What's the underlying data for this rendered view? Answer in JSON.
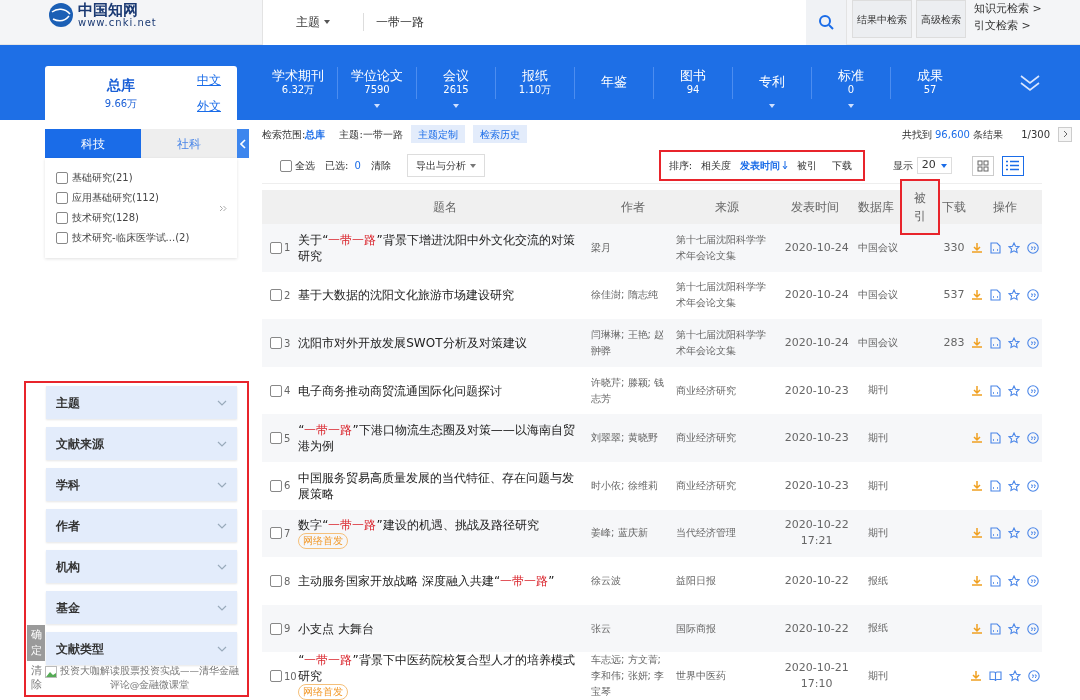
{
  "header": {
    "logo_text": "中国知网",
    "logo_url": "www.cnki.net",
    "search_field": "主题",
    "search_value": "一带一路",
    "buttons": [
      "结果中检索",
      "高级检索"
    ],
    "links": [
      "知识元检索 >",
      "引文检索 >"
    ]
  },
  "library": {
    "title": "总库",
    "count": "9.66万",
    "langs": [
      "中文",
      "外文"
    ]
  },
  "nav": [
    {
      "label": "学术期刊",
      "count": "6.32万",
      "caret": false
    },
    {
      "label": "学位论文",
      "count": "7590",
      "caret": true
    },
    {
      "label": "会议",
      "count": "2615",
      "caret": true
    },
    {
      "label": "报纸",
      "count": "1.10万",
      "caret": false
    },
    {
      "label": "年鉴",
      "caret": false
    },
    {
      "label": "图书",
      "count": "94",
      "caret": false
    },
    {
      "label": "专利",
      "caret": true
    },
    {
      "label": "标准",
      "count": "0",
      "caret": true
    },
    {
      "label": "成果",
      "count": "57",
      "caret": false
    }
  ],
  "subject_tabs": [
    {
      "label": "科技",
      "selected": true
    },
    {
      "label": "社科",
      "selected": false
    }
  ],
  "subject_items": [
    {
      "label": "基础研究(21)",
      "checked": false
    },
    {
      "label": "应用基础研究(112)",
      "checked": false
    },
    {
      "label": "技术研究(128)",
      "checked": false
    },
    {
      "label": "技术研究-临床医学试...(2)",
      "checked": false
    }
  ],
  "filters": {
    "highlighted": true,
    "groups": [
      {
        "label": "主题",
        "expanded": false
      },
      {
        "label": "文献来源",
        "expanded": false
      },
      {
        "label": "学科",
        "expanded": false
      },
      {
        "label": "作者",
        "expanded": false
      },
      {
        "label": "机构",
        "expanded": false
      },
      {
        "label": "基金",
        "expanded": false
      },
      {
        "label": "文献类型",
        "expanded": false
      }
    ],
    "confirm": "确定",
    "clear": "清除",
    "broken_image_alt": "投资大咖解读股票投资实战——清华金融评论@金融微课堂"
  },
  "scope": {
    "label": "检索范围:",
    "value": "总库",
    "topic": "主题:一带一路",
    "buttons": [
      "主题定制",
      "检索历史"
    ],
    "found_prefix": "共找到",
    "found": "96,600",
    "found_suffix": "条结果",
    "page": "1/300"
  },
  "toolbar": {
    "select_all": {
      "label": "全选",
      "checked": false
    },
    "selected_label": "已选:",
    "selected_count": "0",
    "clear": "清除",
    "export": "导出与分析",
    "sort": {
      "label": "排序:",
      "highlighted": true,
      "options": [
        {
          "label": "相关度",
          "selected": false
        },
        {
          "label": "发表时间",
          "selected": true
        },
        {
          "label": "被引",
          "selected": false
        },
        {
          "label": "下载",
          "selected": false
        }
      ]
    },
    "display_label": "显示",
    "page_size": "20",
    "views": [
      {
        "kind": "grid",
        "selected": false
      },
      {
        "kind": "list",
        "selected": true
      }
    ]
  },
  "table": {
    "columns": [
      {
        "label": "题名",
        "highlighted": false
      },
      {
        "label": "作者",
        "highlighted": false
      },
      {
        "label": "来源",
        "highlighted": false
      },
      {
        "label": "发表时间",
        "highlighted": false
      },
      {
        "label": "数据库",
        "highlighted": false
      },
      {
        "label": "被引",
        "highlighted": true
      },
      {
        "label": "下载",
        "highlighted": false
      },
      {
        "label": "操作",
        "highlighted": false
      }
    ],
    "rows": [
      {
        "checked": false,
        "index": "1",
        "title": [
          {
            "text": "关于“",
            "hit": false
          },
          {
            "text": "一带一路",
            "hit": true
          },
          {
            "text": "”背景下增进沈阳中外文化交流的对策研究",
            "hit": false
          }
        ],
        "authors": "梁月",
        "source": "第十七届沈阳科学学术年会论文集",
        "date": "2020-10-24",
        "database": "中国会议",
        "downloads": "330",
        "kind": "doc"
      },
      {
        "checked": false,
        "index": "2",
        "title": [
          {
            "text": "基于大数据的沈阳文化旅游市场建设研究",
            "hit": false
          }
        ],
        "authors": "徐佳澍; 隋志纯",
        "source": "第十七届沈阳科学学术年会论文集",
        "date": "2020-10-24",
        "database": "中国会议",
        "downloads": "537",
        "kind": "doc"
      },
      {
        "checked": false,
        "index": "3",
        "title": [
          {
            "text": "沈阳市对外开放发展SWOT分析及对策建议",
            "hit": false
          }
        ],
        "authors": "闫琳琳; 王艳; 赵翀骅",
        "source": "第十七届沈阳科学学术年会论文集",
        "date": "2020-10-24",
        "database": "中国会议",
        "downloads": "283",
        "kind": "doc"
      },
      {
        "checked": false,
        "index": "4",
        "title": [
          {
            "text": "电子商务推动商贸流通国际化问题探讨",
            "hit": false
          }
        ],
        "authors": "许晓芹; 滕颖; 钱志芳",
        "source": "商业经济研究",
        "date": "2020-10-23",
        "database": "期刊",
        "kind": "doc"
      },
      {
        "checked": false,
        "index": "5",
        "title": [
          {
            "text": "“",
            "hit": false
          },
          {
            "text": "一带一路",
            "hit": true
          },
          {
            "text": "”下港口物流生态圈及对策——以海南自贸港为例",
            "hit": false
          }
        ],
        "authors": "刘翠翠; 黄晓野",
        "source": "商业经济研究",
        "date": "2020-10-23",
        "database": "期刊",
        "kind": "doc"
      },
      {
        "checked": false,
        "index": "6",
        "title": [
          {
            "text": "中国服务贸易高质量发展的当代特征、存在问题与发展策略",
            "hit": false
          }
        ],
        "authors": "时小依; 徐维莉",
        "source": "商业经济研究",
        "date": "2020-10-23",
        "database": "期刊",
        "kind": "doc"
      },
      {
        "checked": false,
        "index": "7",
        "title": [
          {
            "text": "数字“",
            "hit": false
          },
          {
            "text": "一带一路",
            "hit": true
          },
          {
            "text": "”建设的机遇、挑战及路径研究",
            "hit": false
          }
        ],
        "tag": "网络首发",
        "authors": "姜峰; 蓝庆新",
        "source": "当代经济管理",
        "date": "2020-10-22",
        "time": "17:21",
        "database": "期刊",
        "kind": "doc"
      },
      {
        "checked": false,
        "index": "8",
        "title": [
          {
            "text": "主动服务国家开放战略 深度融入共建“",
            "hit": false
          },
          {
            "text": "一带一路",
            "hit": true
          },
          {
            "text": "”",
            "hit": false
          }
        ],
        "authors": "徐云波",
        "source": "益阳日报",
        "date": "2020-10-22",
        "database": "报纸",
        "kind": "doc"
      },
      {
        "checked": false,
        "index": "9",
        "title": [
          {
            "text": "小支点 大舞台",
            "hit": false
          }
        ],
        "authors": "张云",
        "source": "国际商报",
        "date": "2020-10-22",
        "database": "报纸",
        "kind": "doc"
      },
      {
        "checked": false,
        "index": "10",
        "title": [
          {
            "text": "“",
            "hit": false
          },
          {
            "text": "一带一路",
            "hit": true
          },
          {
            "text": "”背景下中医药院校复合型人才的培养模式研究",
            "hit": false
          }
        ],
        "tag": "网络首发",
        "authors": "车志远; 方文菁; 李和伟; 张妍; 李宝琴",
        "source": "世界中医药",
        "date": "2020-10-21",
        "time": "17:10",
        "database": "期刊",
        "kind": "book"
      }
    ]
  }
}
